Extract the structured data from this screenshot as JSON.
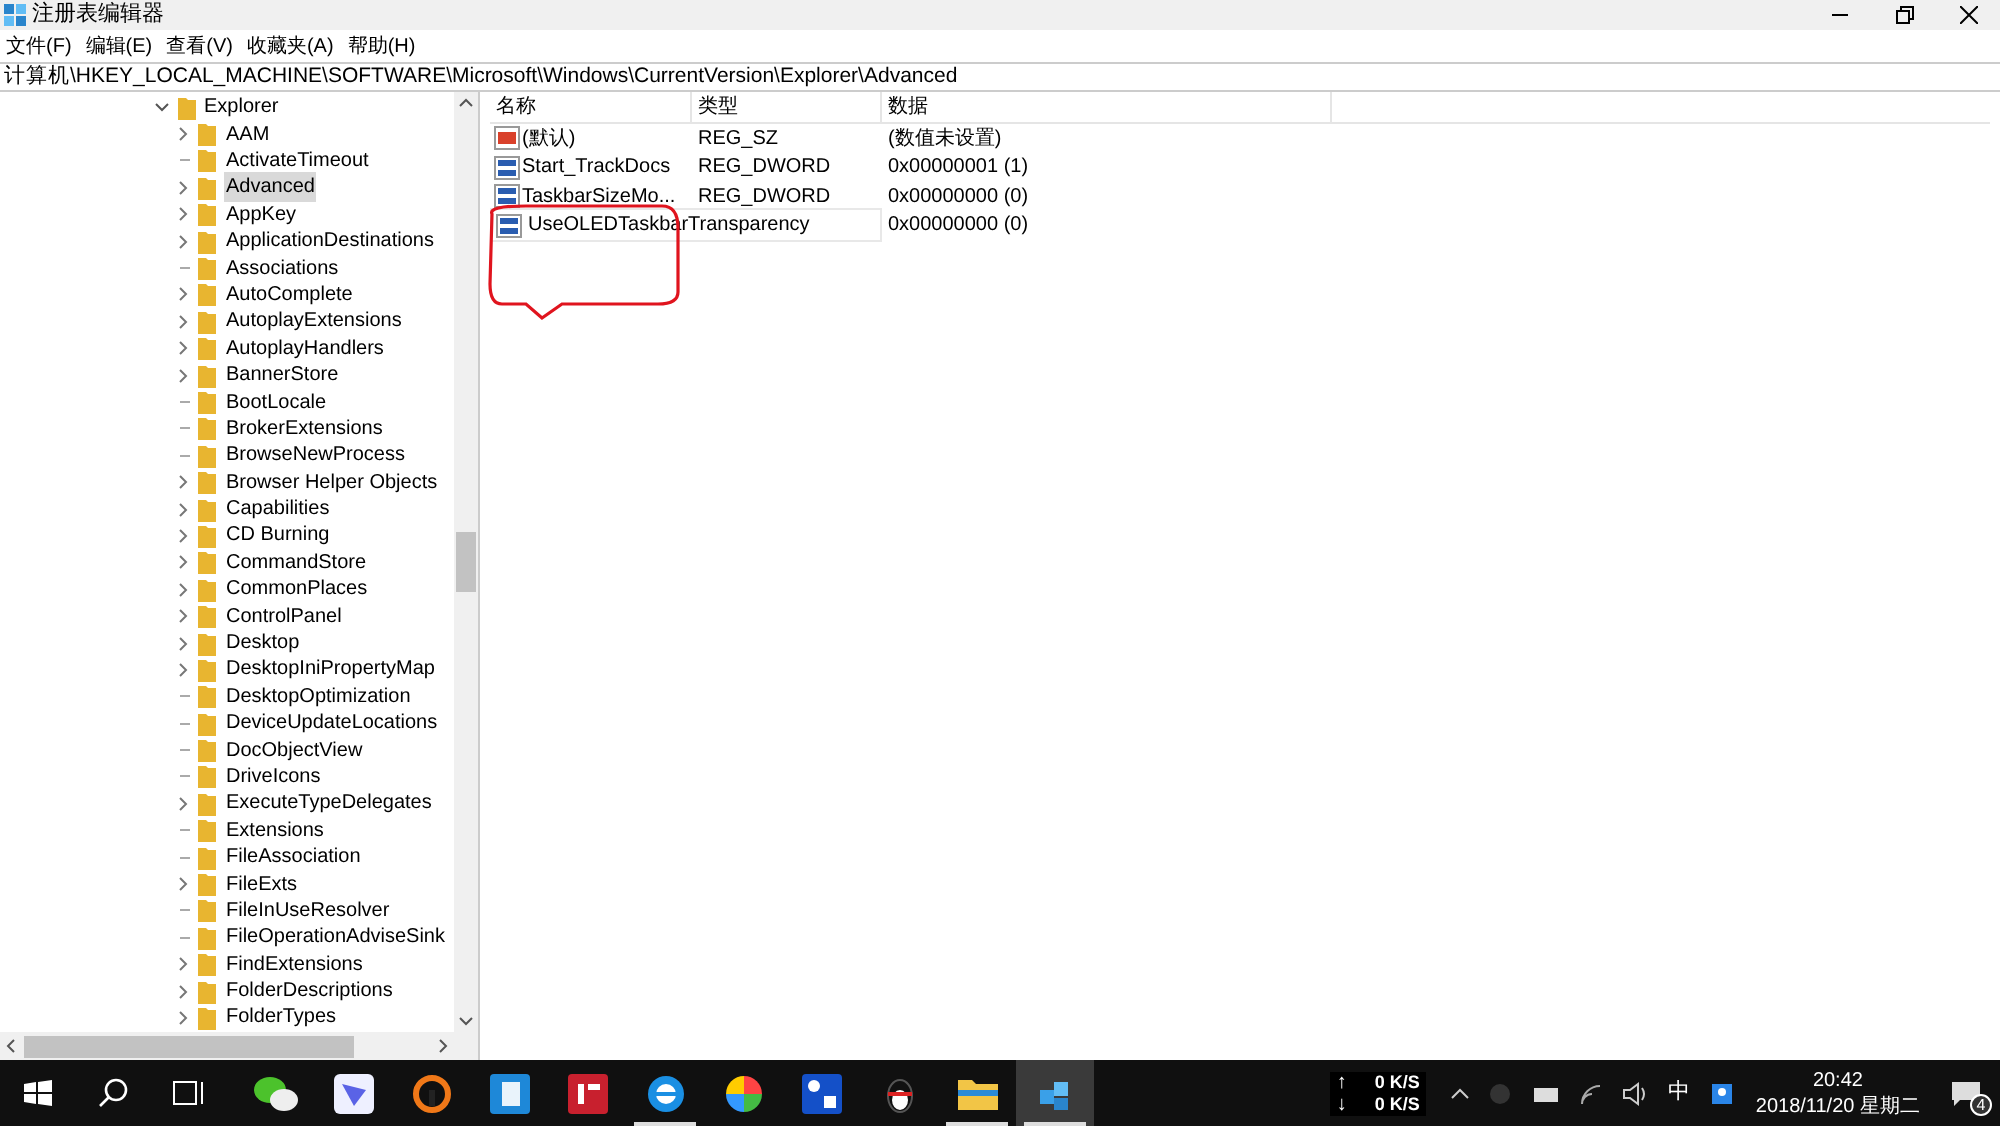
{
  "window": {
    "title": "注册表编辑器"
  },
  "menu": [
    "文件(F)",
    "编辑(E)",
    "查看(V)",
    "收藏夹(A)",
    "帮助(H)"
  ],
  "address": "计算机\\HKEY_LOCAL_MACHINE\\SOFTWARE\\Microsoft\\Windows\\CurrentVersion\\Explorer\\Advanced",
  "tree": {
    "label": "Explorer",
    "expanded": true,
    "children": [
      {
        "label": "AAM",
        "expandable": true,
        "selected": false
      },
      {
        "label": "ActivateTimeout",
        "expandable": false,
        "selected": false
      },
      {
        "label": "Advanced",
        "expandable": true,
        "selected": true
      },
      {
        "label": "AppKey",
        "expandable": true,
        "selected": false
      },
      {
        "label": "ApplicationDestinations",
        "expandable": true,
        "selected": false
      },
      {
        "label": "Associations",
        "expandable": false,
        "selected": false
      },
      {
        "label": "AutoComplete",
        "expandable": true,
        "selected": false
      },
      {
        "label": "AutoplayExtensions",
        "expandable": true,
        "selected": false
      },
      {
        "label": "AutoplayHandlers",
        "expandable": true,
        "selected": false
      },
      {
        "label": "BannerStore",
        "expandable": true,
        "selected": false
      },
      {
        "label": "BootLocale",
        "expandable": false,
        "selected": false
      },
      {
        "label": "BrokerExtensions",
        "expandable": false,
        "selected": false
      },
      {
        "label": "BrowseNewProcess",
        "expandable": false,
        "selected": false
      },
      {
        "label": "Browser Helper Objects",
        "expandable": true,
        "selected": false
      },
      {
        "label": "Capabilities",
        "expandable": true,
        "selected": false
      },
      {
        "label": "CD Burning",
        "expandable": true,
        "selected": false
      },
      {
        "label": "CommandStore",
        "expandable": true,
        "selected": false
      },
      {
        "label": "CommonPlaces",
        "expandable": true,
        "selected": false
      },
      {
        "label": "ControlPanel",
        "expandable": true,
        "selected": false
      },
      {
        "label": "Desktop",
        "expandable": true,
        "selected": false
      },
      {
        "label": "DesktopIniPropertyMap",
        "expandable": true,
        "selected": false
      },
      {
        "label": "DesktopOptimization",
        "expandable": false,
        "selected": false
      },
      {
        "label": "DeviceUpdateLocations",
        "expandable": false,
        "selected": false
      },
      {
        "label": "DocObjectView",
        "expandable": false,
        "selected": false
      },
      {
        "label": "DriveIcons",
        "expandable": false,
        "selected": false
      },
      {
        "label": "ExecuteTypeDelegates",
        "expandable": true,
        "selected": false
      },
      {
        "label": "Extensions",
        "expandable": false,
        "selected": false
      },
      {
        "label": "FileAssociation",
        "expandable": false,
        "selected": false
      },
      {
        "label": "FileExts",
        "expandable": true,
        "selected": false
      },
      {
        "label": "FileInUseResolver",
        "expandable": false,
        "selected": false
      },
      {
        "label": "FileOperationAdviseSink",
        "expandable": false,
        "selected": false
      },
      {
        "label": "FindExtensions",
        "expandable": true,
        "selected": false
      },
      {
        "label": "FolderDescriptions",
        "expandable": true,
        "selected": false
      },
      {
        "label": "FolderTypes",
        "expandable": true,
        "selected": false
      }
    ]
  },
  "table": {
    "columns": [
      "名称",
      "类型",
      "数据"
    ],
    "rows": [
      {
        "kind": "string",
        "name": "(默认)",
        "type": "REG_SZ",
        "data": "(数值未设置)",
        "editing": false
      },
      {
        "kind": "dword",
        "name": "Start_TrackDocs",
        "type": "REG_DWORD",
        "data": "0x00000001 (1)",
        "editing": false
      },
      {
        "kind": "dword",
        "name": "TaskbarSizeMo...",
        "type": "REG_DWORD",
        "data": "0x00000000 (0)",
        "editing": false
      },
      {
        "kind": "dword",
        "name": "UseOLEDTaskbarTransparency",
        "data": "0x00000000 (0)",
        "editing": true
      }
    ]
  },
  "taskbar": {
    "apps": [
      {
        "kind": "wechat",
        "running": false,
        "selected": false
      },
      {
        "kind": "bird",
        "running": false,
        "selected": false
      },
      {
        "kind": "ring",
        "running": false,
        "selected": false
      },
      {
        "kind": "blue",
        "running": false,
        "selected": false
      },
      {
        "kind": "it",
        "running": false,
        "selected": false
      },
      {
        "kind": "edge",
        "running": true,
        "selected": false
      },
      {
        "kind": "pinwheel",
        "running": false,
        "selected": false
      },
      {
        "kind": "tools",
        "running": false,
        "selected": false
      },
      {
        "kind": "penguin",
        "running": false,
        "selected": false
      },
      {
        "kind": "folder",
        "running": true,
        "selected": false
      },
      {
        "kind": "regedit",
        "running": true,
        "selected": true
      }
    ],
    "up_arrow": "↑",
    "down_arrow": "↓",
    "upload": "0 K/S",
    "download": "0 K/S",
    "ime": "中",
    "time": "20:42",
    "date": "2018/11/20 星期二",
    "notifications": "4"
  }
}
